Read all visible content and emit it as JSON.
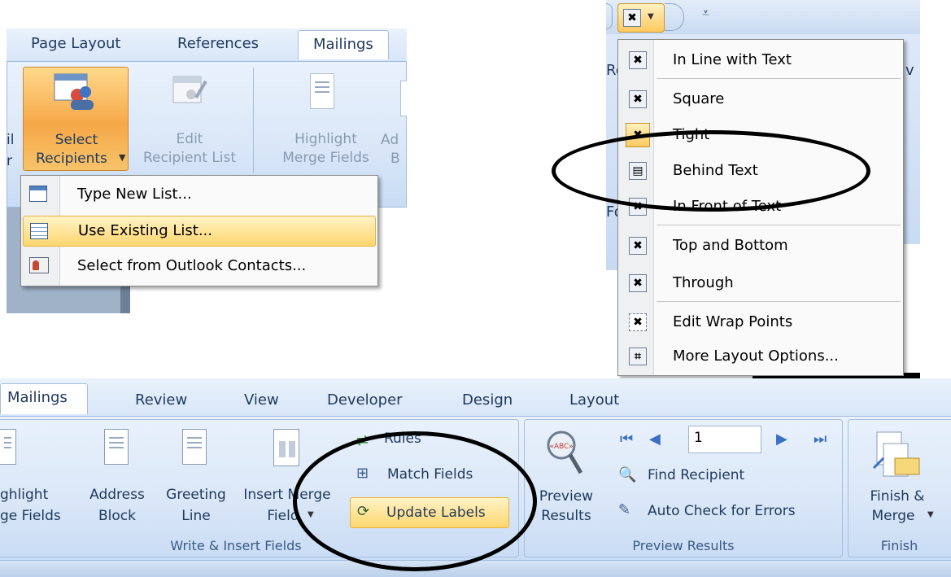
{
  "panel1": {
    "tabs": [
      "Page Layout",
      "References",
      "Mailings"
    ],
    "buttons": {
      "select_recipients": [
        "Select",
        "Recipients"
      ],
      "edit_recipient_list": [
        "Edit",
        "Recipient List"
      ],
      "highlight_merge_fields": [
        "Highlight",
        "Merge Fields"
      ],
      "left_cut": [
        "il",
        "r"
      ],
      "right_cut": [
        "Ad",
        "B"
      ]
    },
    "menu": {
      "type_new_list": "Type New List...",
      "use_existing_list": "Use Existing List...",
      "select_from_outlook": "Select from Outlook Contacts..."
    }
  },
  "panel2": {
    "edge_text": [
      "Re",
      "v",
      "Fo"
    ],
    "menu": {
      "in_line": "In Line with Text",
      "square": "Square",
      "tight": "Tight",
      "behind_text": "Behind Text",
      "in_front": "In Front of Text",
      "top_bottom": "Top and Bottom",
      "through": "Through",
      "edit_wrap": "Edit Wrap Points",
      "more_layout": "More Layout Options..."
    }
  },
  "panel3": {
    "tabs": [
      "Mailings",
      "Review",
      "View",
      "Developer",
      "Design",
      "Layout"
    ],
    "buttons": {
      "highlight": [
        "ghlight",
        "ge Fields"
      ],
      "address_block": [
        "Address",
        "Block"
      ],
      "greeting_line": [
        "Greeting",
        "Line"
      ],
      "insert_merge": [
        "Insert Merge",
        "Field"
      ],
      "rules": "Rules",
      "match_fields": "Match Fields",
      "update_labels": "Update Labels",
      "preview_results": [
        "Preview",
        "Results"
      ],
      "record_number": "1",
      "find_recipient": "Find Recipient",
      "auto_check": "Auto Check for Errors",
      "finish_merge": [
        "Finish &",
        "Merge"
      ]
    },
    "groups": {
      "write_insert": "Write & Insert Fields",
      "preview": "Preview Results",
      "finish": "Finish"
    }
  }
}
